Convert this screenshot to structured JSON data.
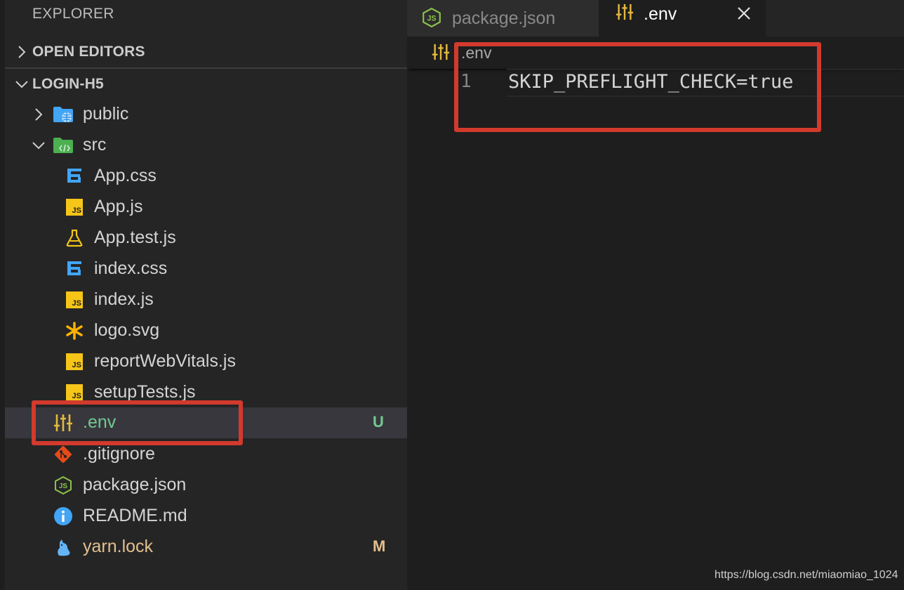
{
  "sidebar": {
    "title": "EXPLORER",
    "open_editors_label": "OPEN EDITORS",
    "project_label": "LOGIN-H5",
    "tree": [
      {
        "label": "public",
        "icon": "folder-public-icon"
      },
      {
        "label": "src",
        "icon": "folder-src-icon"
      },
      {
        "label": "App.css",
        "icon": "css-icon"
      },
      {
        "label": "App.js",
        "icon": "js-icon",
        "badge_text": "JS"
      },
      {
        "label": "App.test.js",
        "icon": "test-flask-icon"
      },
      {
        "label": "index.css",
        "icon": "css-icon"
      },
      {
        "label": "index.js",
        "icon": "js-icon",
        "badge_text": "JS"
      },
      {
        "label": "logo.svg",
        "icon": "svg-asterisk-icon"
      },
      {
        "label": "reportWebVitals.js",
        "icon": "js-icon",
        "badge_text": "JS"
      },
      {
        "label": "setupTests.js",
        "icon": "js-icon",
        "badge_text": "JS"
      },
      {
        "label": ".env",
        "icon": "env-settings-icon",
        "git_status": "U",
        "selected": true
      },
      {
        "label": ".gitignore",
        "icon": "git-icon"
      },
      {
        "label": "package.json",
        "icon": "nodejs-icon"
      },
      {
        "label": "README.md",
        "icon": "info-icon"
      },
      {
        "label": "yarn.lock",
        "icon": "yarn-cat-icon",
        "git_status": "M"
      }
    ]
  },
  "tabs": [
    {
      "label": "package.json",
      "icon": "nodejs-icon",
      "active": false
    },
    {
      "label": ".env",
      "icon": "env-settings-icon",
      "active": true
    }
  ],
  "editor": {
    "breadcrumb": ".env",
    "lines": [
      {
        "number": "1",
        "text": "SKIP_PREFLIGHT_CHECK=true"
      }
    ]
  },
  "watermark": "https://blog.csdn.net/miaomiao_1024",
  "colors": {
    "sidebar_bg": "#252526",
    "editor_bg": "#1e1e1e",
    "selected_row_bg": "#37373d",
    "untracked_green": "#73c991",
    "modified_gold": "#e2c08d",
    "highlight_red": "#d23a2d",
    "js_yellow": "#f5c518",
    "css_blue": "#42a5f5",
    "env_yellow": "#e5b93e"
  }
}
